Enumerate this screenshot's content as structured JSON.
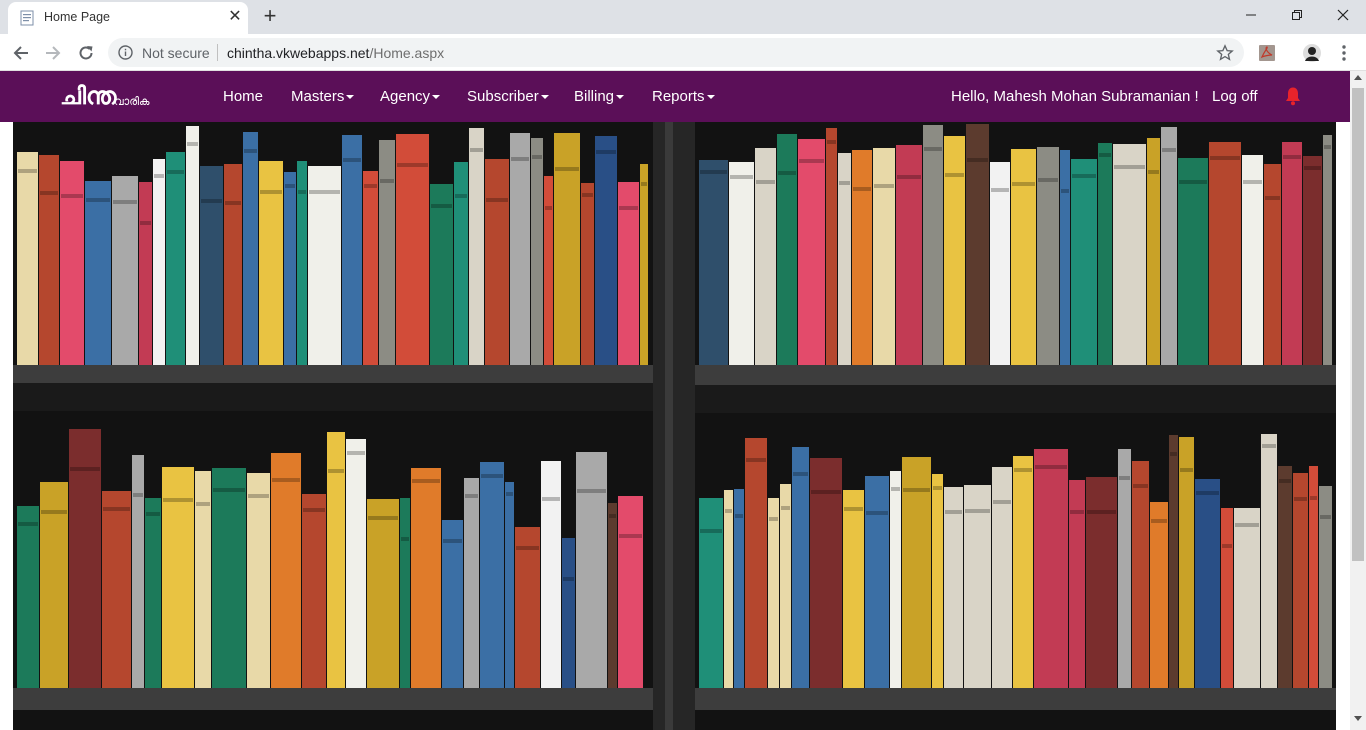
{
  "browser": {
    "tab_title": "Home Page",
    "tab_close": "✕",
    "new_tab": "+",
    "security_label": "Not secure",
    "url_host": "chintha.vkwebapps.net",
    "url_path": "/Home.aspx"
  },
  "site": {
    "logo_main": "ചിന്ത",
    "logo_sub": "വാരിക",
    "nav": [
      {
        "label": "Home",
        "dropdown": false
      },
      {
        "label": "Masters",
        "dropdown": true
      },
      {
        "label": "Agency",
        "dropdown": true
      },
      {
        "label": "Subscriber",
        "dropdown": true
      },
      {
        "label": "Billing",
        "dropdown": true
      },
      {
        "label": "Reports",
        "dropdown": true
      }
    ],
    "greeting": "Hello, Mahesh Mohan Subramanian !",
    "logoff": "Log off",
    "colors": {
      "navbar": "#5b0f58",
      "bell": "#e8232b"
    }
  },
  "hero": {
    "image": "bookshelf-photo"
  }
}
